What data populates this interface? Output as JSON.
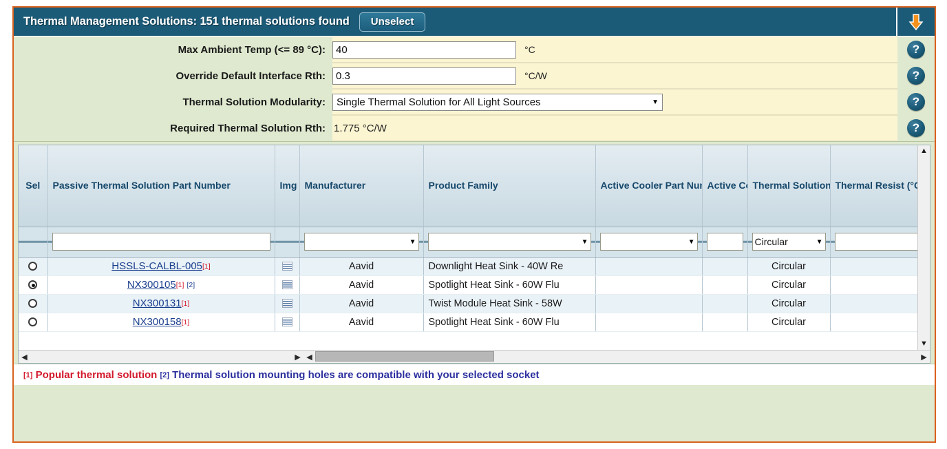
{
  "header": {
    "title": "Thermal Management Solutions: 151 thermal solutions found",
    "unselect_label": "Unselect",
    "collapse_icon": "down-arrow-icon",
    "result_count": "151"
  },
  "form": {
    "help_icon_label": "?",
    "rows": [
      {
        "label": "Max Ambient Temp (<= 89 °C):",
        "type": "text",
        "value": "40",
        "unit": "°C"
      },
      {
        "label": "Override Default Interface Rth:",
        "type": "text",
        "value": "0.3",
        "unit": "°C/W"
      },
      {
        "label": "Thermal Solution Modularity:",
        "type": "select",
        "value": "Single Thermal Solution for All Light Sources",
        "unit": ""
      },
      {
        "label": "Required Thermal Solution Rth:",
        "type": "static",
        "value": "1.775 °C/W",
        "unit": ""
      }
    ]
  },
  "grid": {
    "columns": [
      "Sel",
      "Passive Thermal Solution Part Number",
      "Img",
      "Manufacturer",
      "Product Family",
      "Active Cooler Part Number",
      "Active Cooler Count",
      "Thermal Solution Shape",
      "Thermal Resist (°C/W"
    ],
    "filters": {
      "part_number": "",
      "manufacturer": "",
      "product_family": "",
      "active_cooler_part_number": "",
      "active_cooler_count": "",
      "thermal_solution_shape": "Circular",
      "thermal_resistance": ""
    },
    "rows": [
      {
        "selected": false,
        "part_number": "HSSLS-CALBL-005",
        "marks": [
          "[1]"
        ],
        "img_icon": "document-thumbnail-icon",
        "manufacturer": "Aavid",
        "product_family": "Downlight Heat Sink - 40W Re",
        "active_cooler_part_number": "",
        "active_cooler_count": "",
        "thermal_solution_shape": "Circular",
        "thermal_resistance": ""
      },
      {
        "selected": true,
        "part_number": "NX300105",
        "marks": [
          "[1]",
          "[2]"
        ],
        "img_icon": "document-thumbnail-icon",
        "manufacturer": "Aavid",
        "product_family": "Spotlight Heat Sink - 60W Flu",
        "active_cooler_part_number": "",
        "active_cooler_count": "",
        "thermal_solution_shape": "Circular",
        "thermal_resistance": ""
      },
      {
        "selected": false,
        "part_number": "NX300131",
        "marks": [
          "[1]"
        ],
        "img_icon": "document-thumbnail-icon",
        "manufacturer": "Aavid",
        "product_family": "Twist Module Heat Sink - 58W",
        "active_cooler_part_number": "",
        "active_cooler_count": "",
        "thermal_solution_shape": "Circular",
        "thermal_resistance": ""
      },
      {
        "selected": false,
        "part_number": "NX300158",
        "marks": [
          "[1]"
        ],
        "img_icon": "document-thumbnail-icon",
        "manufacturer": "Aavid",
        "product_family": "Spotlight Heat Sink - 60W Flu",
        "active_cooler_part_number": "",
        "active_cooler_count": "",
        "thermal_solution_shape": "Circular",
        "thermal_resistance": ""
      }
    ],
    "scroll": {
      "up_arrow": "▲",
      "down_arrow": "▼",
      "left_arrow": "◀",
      "right_arrow": "▶"
    }
  },
  "footnote": {
    "mark1": "[1]",
    "text1": "Popular thermal solution",
    "mark2": "[2]",
    "text2": "Thermal solution mounting holes are compatible with your selected socket"
  },
  "colors": {
    "frame_border": "#d9611f",
    "titlebar": "#1b5b78",
    "form_background": "#dfe9cf",
    "field_background": "#fcf5d2",
    "header_text": "#16486b",
    "accent_orange": "#f08a1e",
    "mark_red": "#d3182b",
    "mark_blue": "#2b2f9e"
  }
}
